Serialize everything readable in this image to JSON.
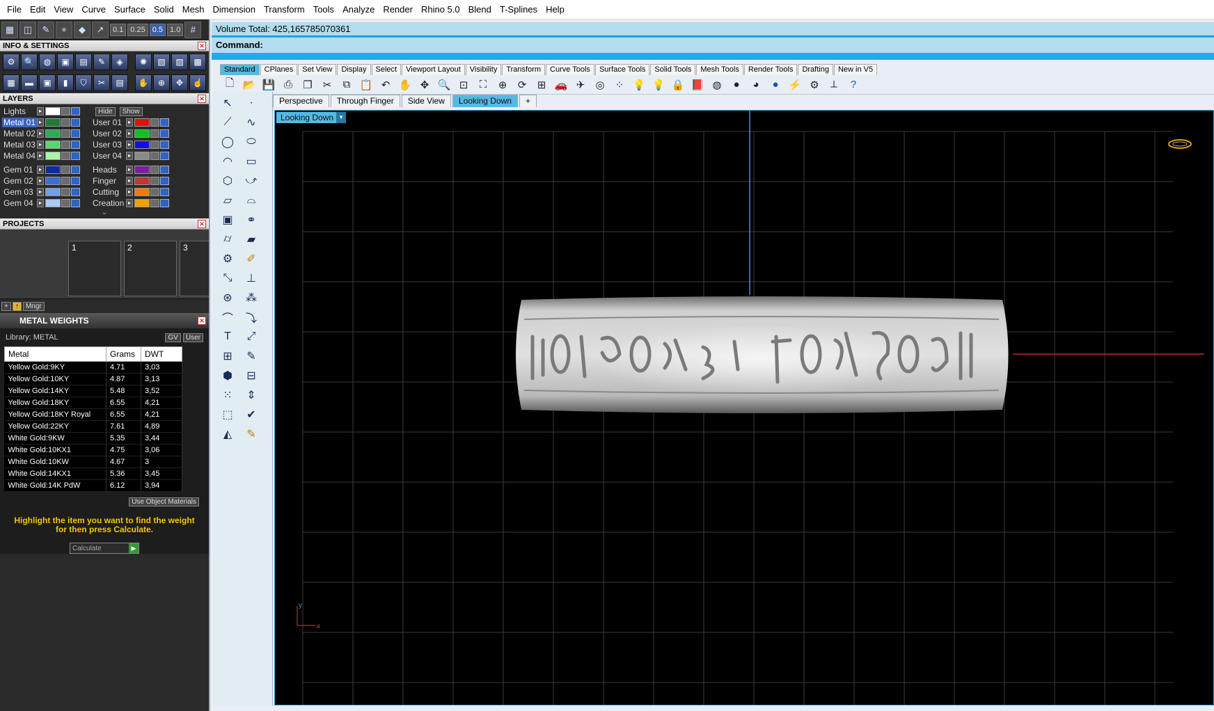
{
  "menu": [
    "File",
    "Edit",
    "View",
    "Curve",
    "Surface",
    "Solid",
    "Mesh",
    "Dimension",
    "Transform",
    "Tools",
    "Analyze",
    "Render",
    "Rhino 5.0",
    "Blend",
    "T-Splines",
    "Help"
  ],
  "left_toolbar": {
    "snap_values": [
      "0.1",
      "0.25",
      "0.5",
      "1.0"
    ],
    "active_snap": "0.5"
  },
  "info_settings": {
    "title": "INFO & SETTINGS"
  },
  "layers": {
    "title": "LAYERS",
    "lights_label": "Lights",
    "hide_label": "Hide",
    "show_label": "Show",
    "left": [
      {
        "name": "Metal 01",
        "color": "#1f7a3a",
        "selected": true
      },
      {
        "name": "Metal 02",
        "color": "#2eaa55"
      },
      {
        "name": "Metal 03",
        "color": "#58d86c"
      },
      {
        "name": "Metal 04",
        "color": "#a8f5a6"
      },
      {
        "name": "Gem 01",
        "color": "#0b2f9a"
      },
      {
        "name": "Gem 02",
        "color": "#3b6fd0"
      },
      {
        "name": "Gem 03",
        "color": "#6ea0ee"
      },
      {
        "name": "Gem 04",
        "color": "#a9c9f7"
      }
    ],
    "right": [
      {
        "name": "User 01",
        "color": "#e01010"
      },
      {
        "name": "User 02",
        "color": "#10c020"
      },
      {
        "name": "User 03",
        "color": "#1010e0"
      },
      {
        "name": "User 04",
        "color": "#8a8a8a"
      },
      {
        "name": "Heads",
        "color": "#7a1fa0"
      },
      {
        "name": "Finger",
        "color": "#b83a3a"
      },
      {
        "name": "Cutting",
        "color": "#f07a10"
      },
      {
        "name": "Creation",
        "color": "#f0a000"
      }
    ]
  },
  "projects": {
    "title": "PROJECTS",
    "slots": [
      "1",
      "2",
      "3"
    ],
    "mgr_label": "Mngr"
  },
  "metal_weights": {
    "title": "METAL WEIGHTS",
    "library": "Library: METAL",
    "gv_label": "GV",
    "user_label": "User",
    "columns": [
      "Metal",
      "Grams",
      "DWT"
    ],
    "rows": [
      [
        "Yellow Gold:9KY",
        "4.71",
        "3,03"
      ],
      [
        "Yellow Gold:10KY",
        "4.87",
        "3,13"
      ],
      [
        "Yellow Gold:14KY",
        "5.48",
        "3,52"
      ],
      [
        "Yellow Gold:18KY",
        "6.55",
        "4,21"
      ],
      [
        "Yellow Gold:18KY Royal",
        "6.55",
        "4,21"
      ],
      [
        "Yellow Gold:22KY",
        "7.61",
        "4,89"
      ],
      [
        "White Gold:9KW",
        "5.35",
        "3,44"
      ],
      [
        "White Gold:10KX1",
        "4.75",
        "3,06"
      ],
      [
        "White Gold:10KW",
        "4.67",
        "3"
      ],
      [
        "White Gold:14KX1",
        "5.36",
        "3,45"
      ],
      [
        "White Gold:14K PdW",
        "6.12",
        "3,94"
      ]
    ],
    "use_object_materials": "Use Object Materials",
    "hint": "Highlight the item you want to find the weight for then press Calculate.",
    "calculate": "Calculate"
  },
  "command_area": {
    "volume": "Volume Total: 425,165785070361",
    "command": "Command:"
  },
  "toolbar_tabs": [
    "Standard",
    "CPlanes",
    "Set View",
    "Display",
    "Select",
    "Viewport Layout",
    "Visibility",
    "Transform",
    "Curve Tools",
    "Surface Tools",
    "Solid Tools",
    "Mesh Tools",
    "Render Tools",
    "Drafting",
    "New in V5"
  ],
  "viewport_tabs": [
    "Perspective",
    "Through Finger",
    "Side View",
    "Looking Down"
  ],
  "active_viewport": "Looking Down",
  "viewport_label": "Looking Down",
  "axis": {
    "x": "x",
    "y": "y"
  }
}
